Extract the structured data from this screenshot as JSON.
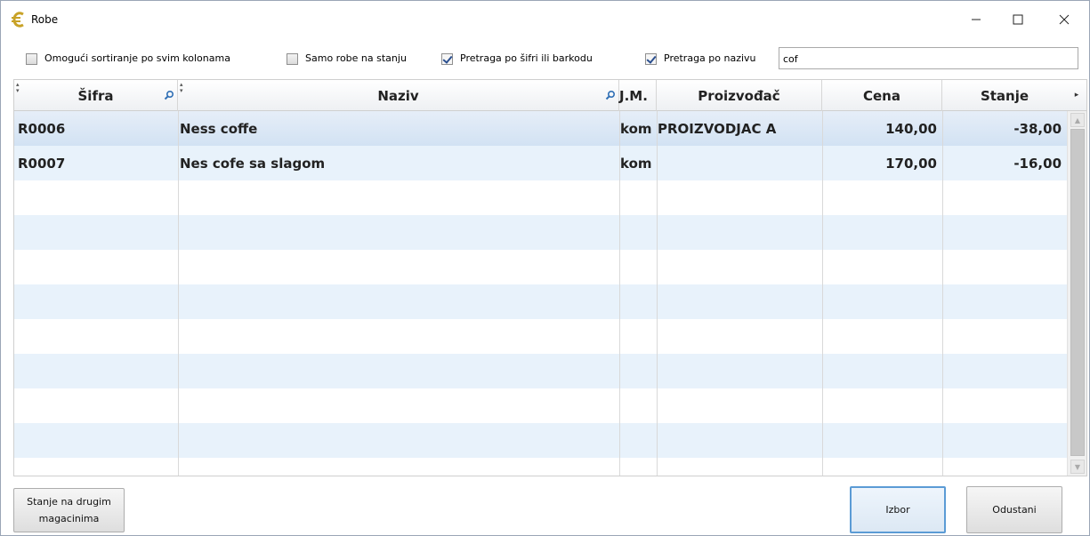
{
  "window": {
    "title": "Robe",
    "minimize_glyph": "—",
    "maximize_glyph": "☐",
    "close_glyph": "✕"
  },
  "filters": {
    "sort_all_columns": {
      "label": "Omogući sortiranje po svim kolonama",
      "checked": false
    },
    "only_in_stock": {
      "label": "Samo robe na stanju",
      "checked": false
    },
    "search_by_code": {
      "label": "Pretraga po šifri ili barkodu",
      "checked": true
    },
    "search_by_name": {
      "label": "Pretraga po nazivu",
      "checked": true
    },
    "search_value": "cof"
  },
  "table": {
    "columns": [
      {
        "key": "sifra",
        "label": "Šifra"
      },
      {
        "key": "naziv",
        "label": "Naziv"
      },
      {
        "key": "jm",
        "label": "J.M."
      },
      {
        "key": "proizvodjac",
        "label": "Proizvođač"
      },
      {
        "key": "cena",
        "label": "Cena"
      },
      {
        "key": "stanje",
        "label": "Stanje"
      }
    ],
    "rows": [
      {
        "sifra": "R0006",
        "naziv": "Ness coffe",
        "jm": "kom",
        "proizvodjac": "PROIZVODJAC A",
        "cena": "140,00",
        "stanje": "-38,00"
      },
      {
        "sifra": "R0007",
        "naziv": "Nes cofe sa slagom",
        "jm": "kom",
        "proizvodjac": "",
        "cena": "170,00",
        "stanje": "-16,00"
      }
    ],
    "header_more_glyph": "▸"
  },
  "buttons": {
    "stock_other_line1": "Stanje na drugim",
    "stock_other_line2": "magacinima",
    "choose": "Izbor",
    "cancel": "Odustani"
  },
  "colors": {
    "selected_row": "#d2e2f3",
    "alt_row": "#e8f2fb",
    "accent_border": "#5b9bd5",
    "app_icon": "#c8a227"
  }
}
